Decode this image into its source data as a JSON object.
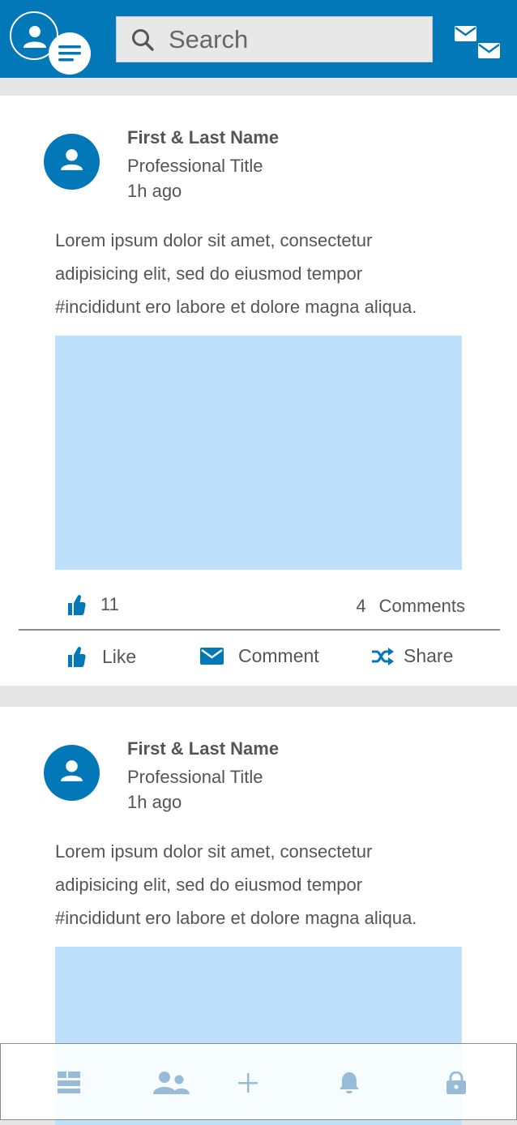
{
  "app": {
    "search_placeholder": "Search"
  },
  "colors": {
    "brand": "#0378b8",
    "image_placeholder": "#bde0fc",
    "nav_icon": "#98bbd8",
    "text": "#555555"
  },
  "icons": {
    "profile": "person-icon",
    "menu": "menu-lines-icon",
    "search": "search-icon",
    "messages": "envelopes-icon",
    "like": "thumbs-up-icon",
    "comment": "envelope-icon",
    "share": "shuffle-icon",
    "nav": [
      "feed-icon",
      "people-icon",
      "plus-icon",
      "bell-icon",
      "lock-icon"
    ]
  },
  "posts": [
    {
      "author_name": "First & Last Name",
      "author_title": "Professional Title",
      "time": "1h ago",
      "body_lines": [
        "Lorem ipsum dolor sit amet, consectetur",
        "adipisicing elit, sed do eiusmod tempor",
        "#incididunt ero labore et dolore magna aliqua."
      ],
      "likes": "11",
      "comments_count": "4",
      "comments_label": "Comments",
      "actions": {
        "like": "Like",
        "comment": "Comment",
        "share": "Share"
      }
    },
    {
      "author_name": "First & Last Name",
      "author_title": "Professional Title",
      "time": "1h ago",
      "body_lines": [
        "Lorem ipsum dolor sit amet, consectetur",
        "adipisicing elit, sed do eiusmod tempor",
        "#incididunt ero labore et dolore magna aliqua."
      ]
    }
  ]
}
